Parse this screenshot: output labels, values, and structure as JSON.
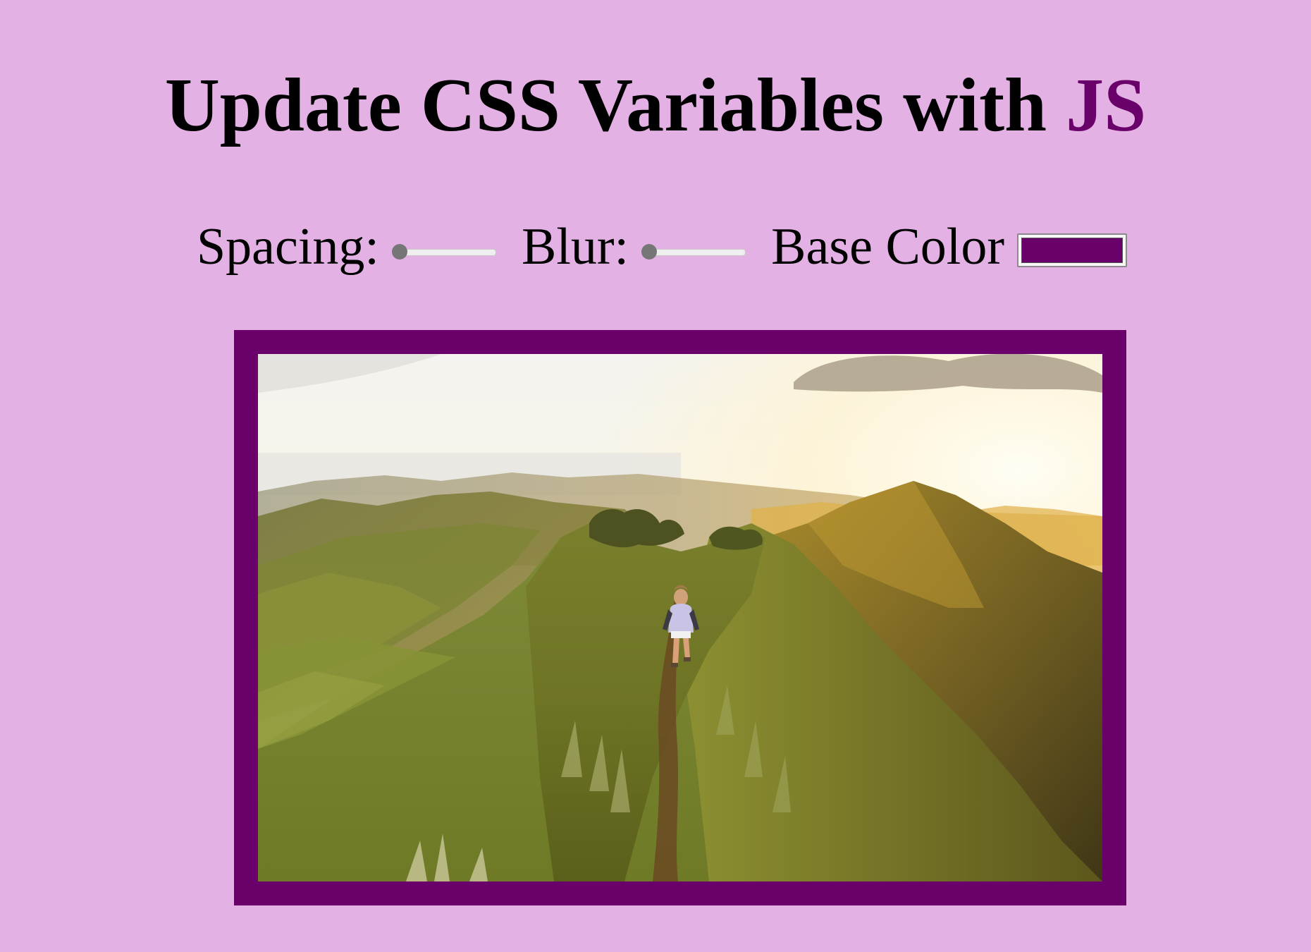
{
  "header": {
    "title_prefix": "Update CSS Variables with ",
    "title_highlight": "JS"
  },
  "controls": {
    "spacing_label": "Spacing:",
    "spacing_value": 10,
    "spacing_range": [
      10,
      200
    ],
    "blur_label": "Blur:",
    "blur_value": 0,
    "blur_range": [
      0,
      25
    ],
    "base_color_label": "Base Color",
    "base_color_value": "#6a006a"
  },
  "colors": {
    "background": "#e4b1e4",
    "accent": "#6a006a"
  },
  "image": {
    "alt": "hiker on a mountain ridge at sunset"
  }
}
